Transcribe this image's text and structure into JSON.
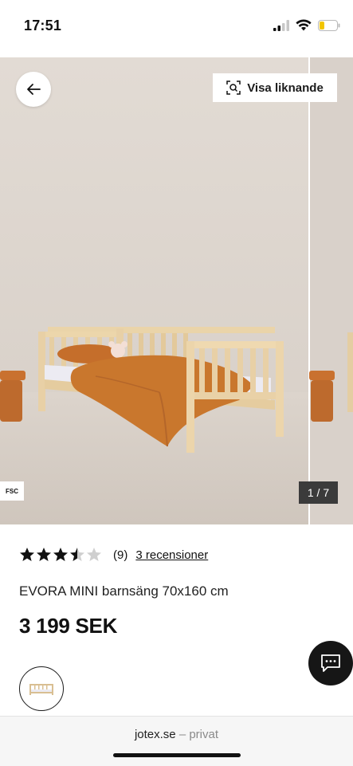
{
  "status": {
    "time": "17:51"
  },
  "gallery": {
    "similar_label": "Visa liknande",
    "fsc_label": "FSC",
    "counter": "1 / 7",
    "current_image": 1,
    "total_images": 7
  },
  "product": {
    "rating": 3.5,
    "rating_max": 5,
    "rating_count": "(9)",
    "reviews_link": "3 recensioner",
    "title": "EVORA MINI barnsäng 70x160 cm",
    "price": "3 199 SEK"
  },
  "browser": {
    "domain": "jotex.se",
    "note": "– privat"
  },
  "colors": {
    "accent": "#161616",
    "background": "#ffffff",
    "wall": "#ddd6cf",
    "bedding": "#c9772d",
    "wood": "#e6cfa4"
  }
}
